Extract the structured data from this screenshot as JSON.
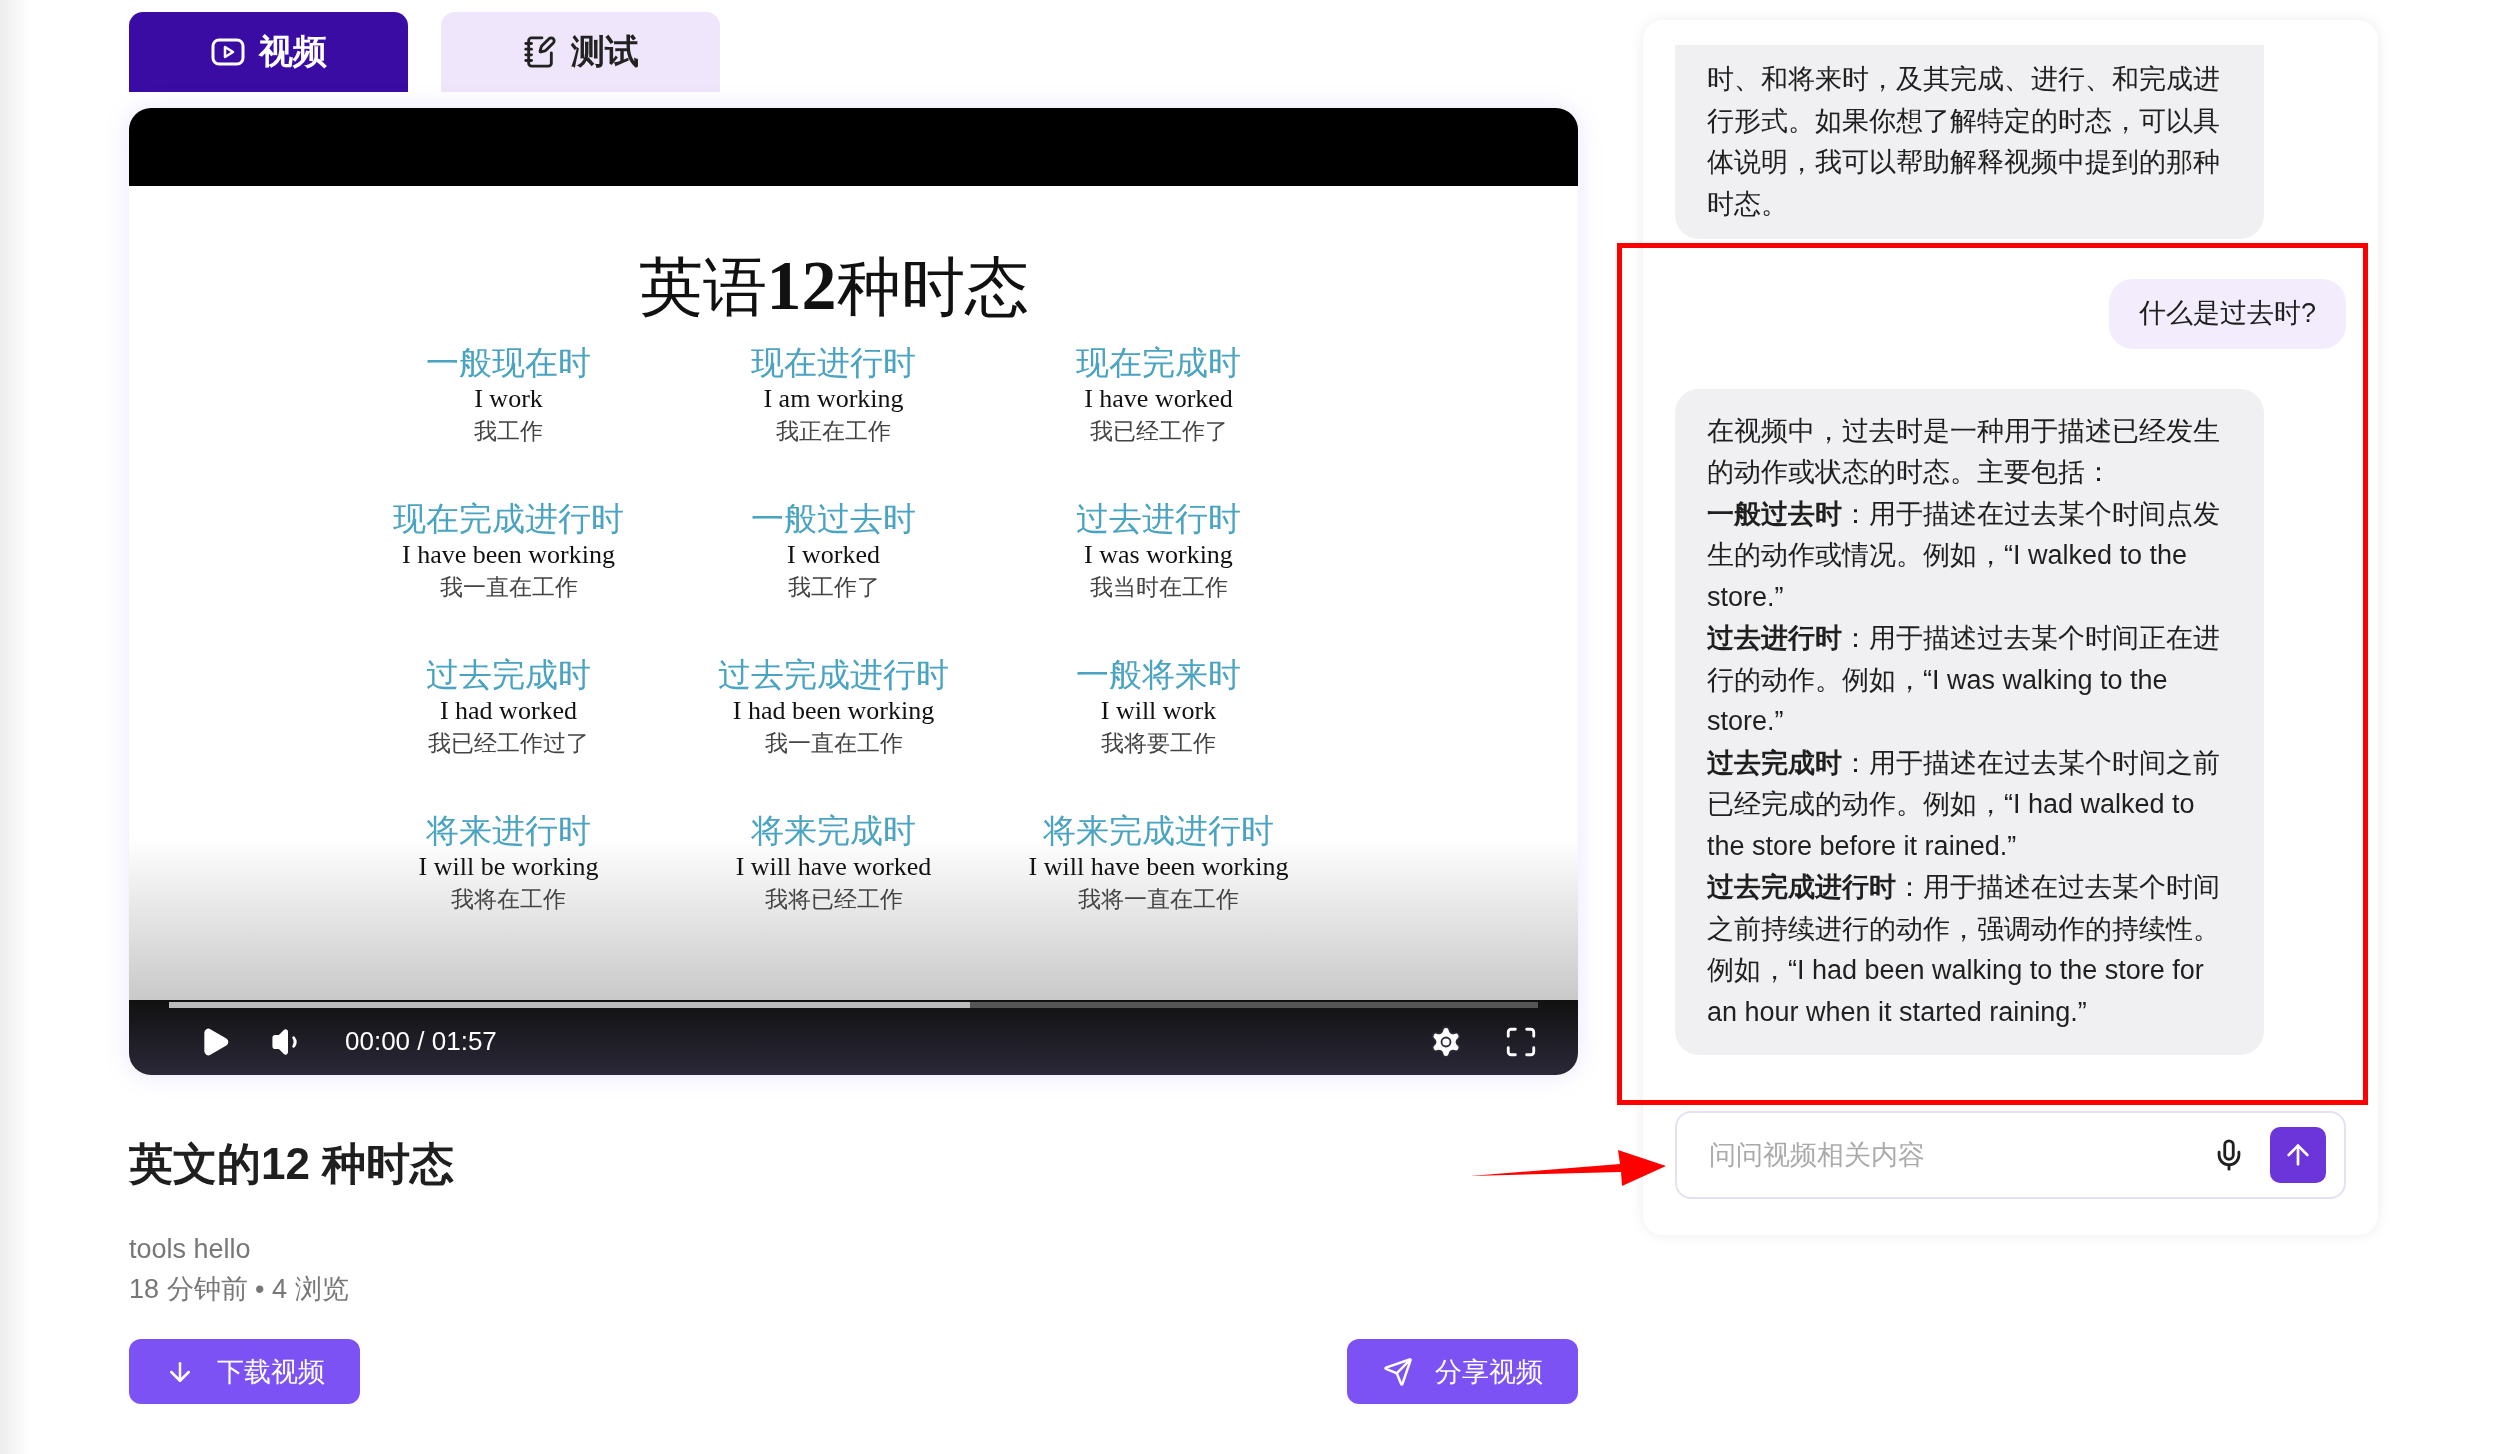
{
  "tabs": [
    {
      "kind": "video",
      "label": "视频",
      "selected": true
    },
    {
      "kind": "quiz",
      "label": "测试",
      "selected": false
    }
  ],
  "slide": {
    "title": "英语**12**种时态",
    "tenses": [
      {
        "name": "一般现在时",
        "english": "I work",
        "chinese": "我工作"
      },
      {
        "name": "现在进行时",
        "english": "I am working",
        "chinese": "我正在工作"
      },
      {
        "name": "现在完成时",
        "english": "I have worked",
        "chinese": "我已经工作了"
      },
      {
        "name": "现在完成进行时",
        "english": "I have been working",
        "chinese": "我一直在工作"
      },
      {
        "name": "一般过去时",
        "english": "I worked",
        "chinese": "我工作了"
      },
      {
        "name": "过去进行时",
        "english": "I was working",
        "chinese": "我当时在工作"
      },
      {
        "name": "过去完成时",
        "english": "I had worked",
        "chinese": "我已经工作过了"
      },
      {
        "name": "过去完成进行时",
        "english": "I had been working",
        "chinese": "我一直在工作"
      },
      {
        "name": "一般将来时",
        "english": "I will work",
        "chinese": "我将要工作"
      },
      {
        "name": "将来进行时",
        "english": "I will be working",
        "chinese": "我将在工作"
      },
      {
        "name": "将来完成时",
        "english": "I will have worked",
        "chinese": "我将已经工作"
      },
      {
        "name": "将来完成进行时",
        "english": "I will have been working",
        "chinese": "我将一直在工作"
      }
    ]
  },
  "player": {
    "time": "00:00 / 01:57",
    "level": 0.585
  },
  "video_title": "英文的12 种时态",
  "author": "tools hello",
  "meta": "18 分钟前 • 4 浏览",
  "actions": [
    {
      "kind": "download",
      "label": "下载视频"
    },
    {
      "kind": "share",
      "label": "分享视频"
    }
  ],
  "chat": {
    "messages": [
      {
        "kind": "assistant",
        "paragraphs": [
          "时、和将来时，及其完成、进行、和完成进行形式。如果你想了解特定的时态，可以具体说明，我可以帮助解释视频中提到的那种时态。"
        ]
      },
      {
        "kind": "user",
        "paragraphs": [
          "什么是过去时?"
        ]
      },
      {
        "kind": "assistant",
        "paragraphs": [
          "在视频中，过去时是一种用于描述已经发生的动作或状态的时态。主要包括：",
          "**一般过去时**：用于描述在过去某个时间点发生的动作或情况。例如，“I walked to the store.”",
          "**过去进行时**：用于描述过去某个时间正在进行的动作。例如，“I was walking to the store.”",
          "**过去完成时**：用于描述在过去某个时间之前已经完成的动作。例如，“I had walked to the store before it rained.”",
          "**过去完成进行时**：用于描述在过去某个时间之前持续进行的动作，强调动作的持续性。例如，“I had been walking to the store for an hour when it started raining.”"
        ]
      }
    ],
    "input": {
      "placeholder": "问问视频相关内容"
    }
  }
}
